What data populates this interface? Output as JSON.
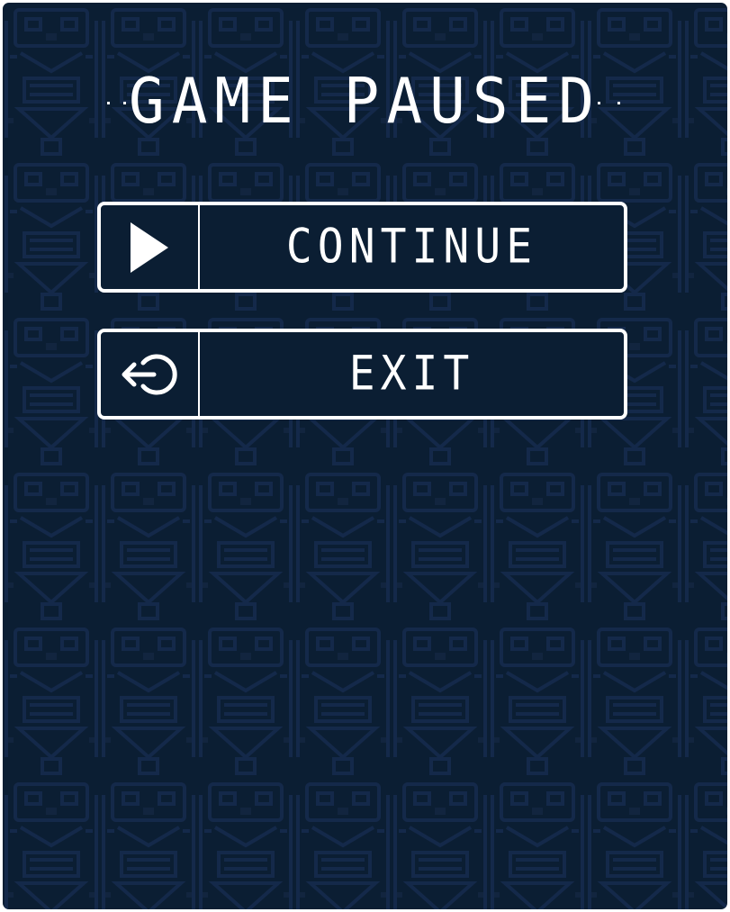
{
  "pause_menu": {
    "title": "GAME PAUSED",
    "buttons": [
      {
        "label": "CONTINUE",
        "icon": "play-icon"
      },
      {
        "label": "EXIT",
        "icon": "exit-icon"
      }
    ]
  },
  "colors": {
    "background": "#0b1e33",
    "pattern": "#14294a",
    "foreground": "#ffffff"
  }
}
